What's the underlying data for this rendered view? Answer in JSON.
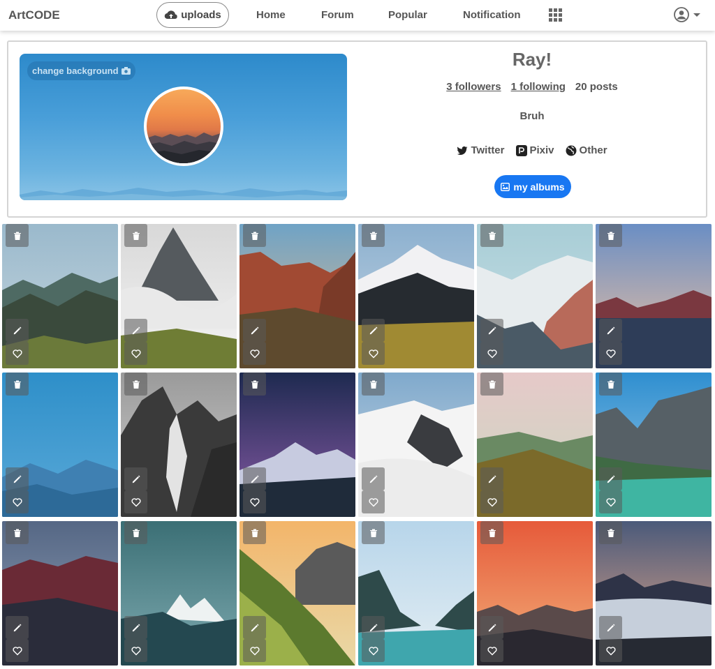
{
  "navbar": {
    "brand": "ArtCODE",
    "uploads_label": "uploads",
    "links": [
      "Home",
      "Forum",
      "Popular",
      "Notification"
    ]
  },
  "profile": {
    "change_background_label": "change background",
    "username": "Ray!",
    "followers": "3 followers",
    "following": "1 following",
    "posts": "20 posts",
    "bio": "Bruh",
    "socials": [
      "Twitter",
      "Pixiv",
      "Other"
    ],
    "albums_label": "my albums"
  },
  "colors": {
    "accent": "#1877f2",
    "text": "#555555"
  },
  "gallery": {
    "icons": [
      "trash-icon",
      "pencil-icon",
      "heart-icon"
    ],
    "images": [
      "misty-mountain-valley",
      "rocky-peak-clouds",
      "red-canyon-valley",
      "snowy-peak-grassland",
      "snowy-ridge-sunset",
      "lake-reflection-dusk",
      "blue-mountain-haze",
      "black-white-peaks",
      "milky-way-mountains",
      "snowy-peak-sea-of-clouds",
      "green-hills-sunrise",
      "turquoise-alpine-lake",
      "red-mountain-range",
      "teal-snowy-peak",
      "golden-hour-slope",
      "mountain-lake-valley",
      "orange-sunset-peaks",
      "sea-of-clouds-dawn"
    ]
  }
}
